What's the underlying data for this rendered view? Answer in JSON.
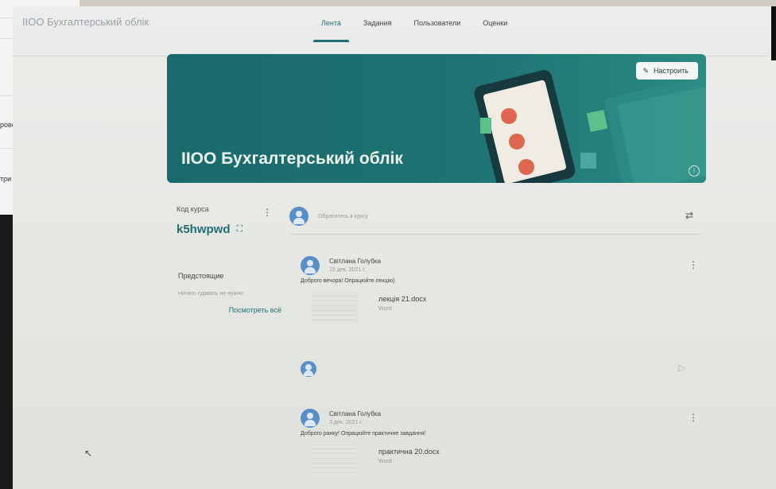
{
  "background_window": {
    "fragment_1": "рово",
    "fragment_2": "три"
  },
  "app": {
    "title": "IIOO Бухгалтерський облік"
  },
  "tabs": [
    {
      "label": "Лента",
      "active": true
    },
    {
      "label": "Задания",
      "active": false
    },
    {
      "label": "Пользователи",
      "active": false
    },
    {
      "label": "Оценки",
      "active": false
    }
  ],
  "banner": {
    "title": "IIOO Бухгалтерський облік",
    "customize_label": "Настроить",
    "accent_color": "#1e7272"
  },
  "course_code": {
    "label": "Код курса",
    "value": "k5hwpwd"
  },
  "upcoming": {
    "title": "Предстоящие",
    "note": "Ничего сдавать не нужно",
    "link": "Посмотреть всё"
  },
  "stream": {
    "announce_placeholder": "Обратитесь к курсу",
    "posts": [
      {
        "author": "Світлана Голубка",
        "date": "15 дек. 2021 г.",
        "text": "Доброго вечора! Опрацюйте лекцію)",
        "attachment": {
          "name": "лекція 21.docx",
          "type": "Word"
        }
      },
      {
        "author": "Світлана Голубка",
        "date": "3 дек. 2021 г.",
        "text": "Доброго ранку! Опрацюйте практичне завдання!",
        "attachment": {
          "name": "практична 20.docx",
          "type": "Word"
        }
      }
    ]
  },
  "icons": {
    "pencil": "pencil-icon",
    "copy": "fullscreen-icon",
    "more": "more-vert-icon",
    "repost": "repost-icon",
    "send": "send-icon",
    "info": "info-icon"
  }
}
